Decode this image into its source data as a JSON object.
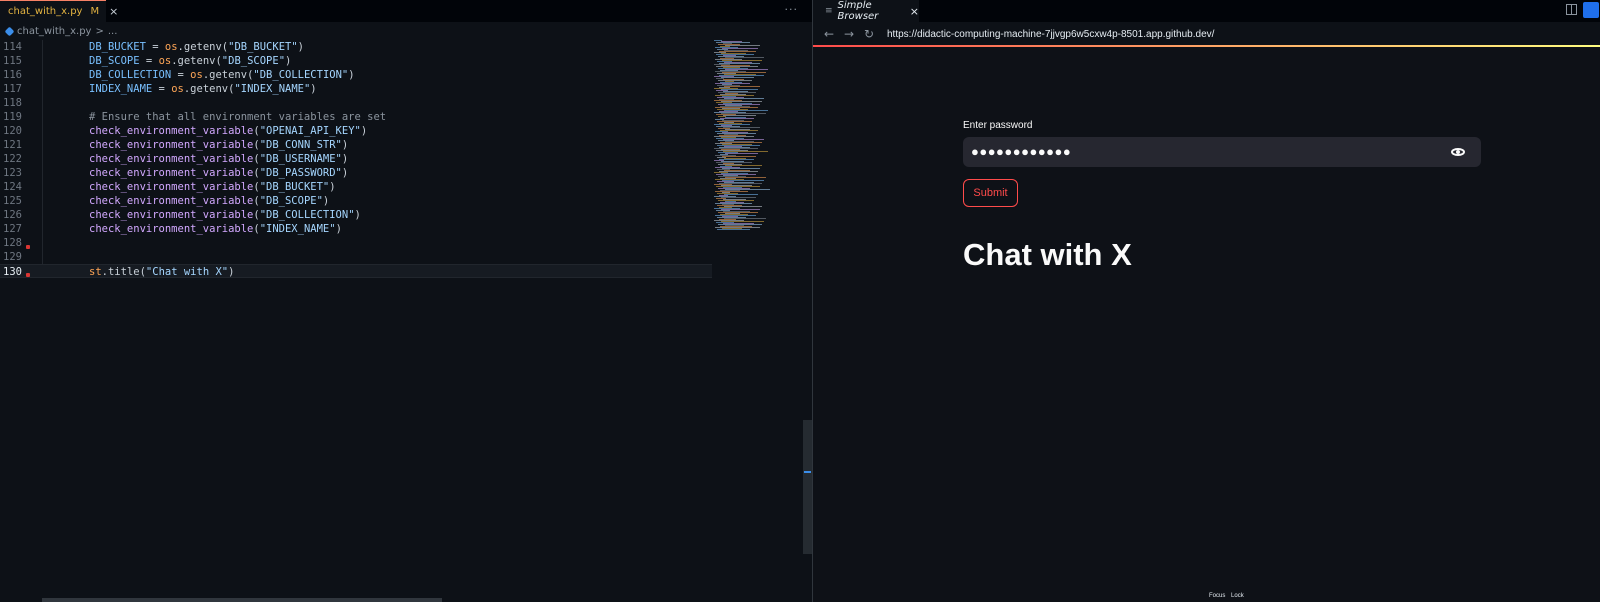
{
  "editor": {
    "tab": {
      "filename": "chat_with_x.py",
      "modified": "M",
      "close": "×",
      "more": "···"
    },
    "breadcrumb": {
      "file": "chat_with_x.py",
      "sep": ">",
      "rest": "..."
    },
    "lines": [
      {
        "num": "114",
        "indent": "",
        "tokens": [
          [
            "var",
            "DB_BUCKET"
          ],
          [
            "",
            "= "
          ],
          [
            "obj",
            "os"
          ],
          [
            "",
            ".getenv("
          ],
          [
            "str",
            "\"DB_BUCKET\""
          ],
          [
            "",
            ")"
          ]
        ]
      },
      {
        "num": "115",
        "indent": "",
        "tokens": [
          [
            "var",
            "DB_SCOPE"
          ],
          [
            "",
            "= "
          ],
          [
            "obj",
            "os"
          ],
          [
            "",
            ".getenv("
          ],
          [
            "str",
            "\"DB_SCOPE\""
          ],
          [
            "",
            ")"
          ]
        ]
      },
      {
        "num": "116",
        "indent": "",
        "tokens": [
          [
            "var",
            "DB_COLLECTION"
          ],
          [
            "",
            "= "
          ],
          [
            "obj",
            "os"
          ],
          [
            "",
            ".getenv("
          ],
          [
            "str",
            "\"DB_COLLECTION\""
          ],
          [
            "",
            ")"
          ]
        ]
      },
      {
        "num": "117",
        "indent": "",
        "tokens": [
          [
            "var",
            "INDEX_NAME"
          ],
          [
            "",
            "= "
          ],
          [
            "obj",
            "os"
          ],
          [
            "",
            ".getenv("
          ],
          [
            "str",
            "\"INDEX_NAME\""
          ],
          [
            "",
            ")"
          ]
        ]
      },
      {
        "num": "118",
        "indent": "",
        "tokens": []
      },
      {
        "num": "119",
        "indent": "",
        "tokens": [
          [
            "cmt",
            "# Ensure that all environment variables are set"
          ]
        ]
      },
      {
        "num": "120",
        "indent": "",
        "tokens": [
          [
            "fn",
            "check_environment_variable"
          ],
          [
            "",
            "("
          ],
          [
            "str",
            "\"OPENAI_API_KEY\""
          ],
          [
            "",
            ")"
          ]
        ]
      },
      {
        "num": "121",
        "indent": "",
        "tokens": [
          [
            "fn",
            "check_environment_variable"
          ],
          [
            "",
            "("
          ],
          [
            "str",
            "\"DB_CONN_STR\""
          ],
          [
            "",
            ")"
          ]
        ]
      },
      {
        "num": "122",
        "indent": "",
        "tokens": [
          [
            "fn",
            "check_environment_variable"
          ],
          [
            "",
            "("
          ],
          [
            "str",
            "\"DB_USERNAME\""
          ],
          [
            "",
            ")"
          ]
        ]
      },
      {
        "num": "123",
        "indent": "",
        "tokens": [
          [
            "fn",
            "check_environment_variable"
          ],
          [
            "",
            "("
          ],
          [
            "str",
            "\"DB_PASSWORD\""
          ],
          [
            "",
            ")"
          ]
        ]
      },
      {
        "num": "124",
        "indent": "",
        "tokens": [
          [
            "fn",
            "check_environment_variable"
          ],
          [
            "",
            "("
          ],
          [
            "str",
            "\"DB_BUCKET\""
          ],
          [
            "",
            ")"
          ]
        ]
      },
      {
        "num": "125",
        "indent": "",
        "tokens": [
          [
            "fn",
            "check_environment_variable"
          ],
          [
            "",
            "("
          ],
          [
            "str",
            "\"DB_SCOPE\""
          ],
          [
            "",
            ")"
          ]
        ]
      },
      {
        "num": "126",
        "indent": "",
        "tokens": [
          [
            "fn",
            "check_environment_variable"
          ],
          [
            "",
            "("
          ],
          [
            "str",
            "\"DB_COLLECTION\""
          ],
          [
            "",
            ")"
          ]
        ]
      },
      {
        "num": "127",
        "indent": "",
        "tokens": [
          [
            "fn",
            "check_environment_variable"
          ],
          [
            "",
            "("
          ],
          [
            "str",
            "\"INDEX_NAME\""
          ],
          [
            "",
            ")"
          ]
        ]
      },
      {
        "num": "128",
        "indent": "",
        "tokens": []
      },
      {
        "num": "129",
        "indent": "",
        "tokens": []
      },
      {
        "num": "130",
        "indent": "",
        "tokens": [
          [
            "obj",
            "st"
          ],
          [
            "",
            ".title("
          ],
          [
            "str",
            "\"Chat with X\""
          ],
          [
            "",
            ")"
          ]
        ]
      }
    ],
    "current_line": "130"
  },
  "browser": {
    "tab": {
      "icon": "≡",
      "label": "Simple Browser",
      "close": "×"
    },
    "nav": {
      "back": "←",
      "forward": "→",
      "reload": "↻",
      "url": "https://didactic-computing-machine-7jjvgp6w5cxw4p-8501.app.github.dev/"
    },
    "app": {
      "password_label": "Enter password",
      "password_value": "●●●●●●●●●●●●",
      "submit_label": "Submit",
      "title": "Chat with X"
    },
    "footer": {
      "focus": "Focus",
      "lock": "Lock"
    }
  },
  "colors": {
    "accent": "#ff4b4b",
    "editor_bg": "#0d1117",
    "app_bg": "#0e1117",
    "field_bg": "#262730"
  },
  "icons": [
    "python-file-icon",
    "eye-icon",
    "split-editor-icon",
    "lock-icon",
    "menu-icon"
  ]
}
